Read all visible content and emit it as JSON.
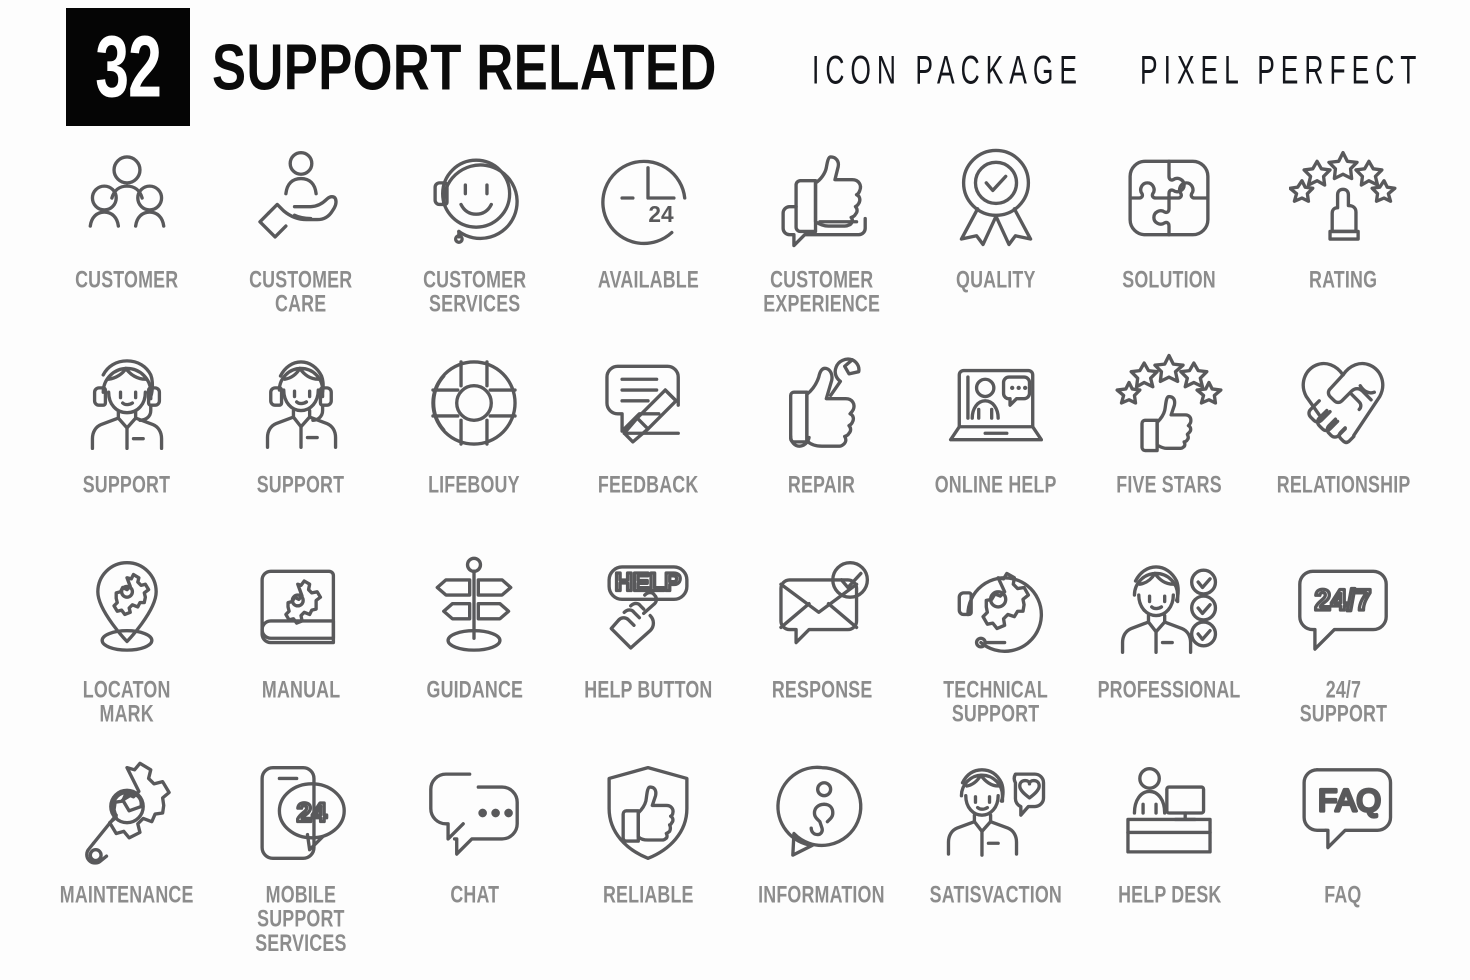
{
  "header": {
    "count": "32",
    "title": "SUPPORT RELATED",
    "subtitle_a": "ICON PACKAGE",
    "subtitle_b": "PIXEL PERFECT"
  },
  "colors": {
    "badge_background": "#050505",
    "badge_text": "#ffffff",
    "title_text": "#0b0b0b",
    "icon_stroke": "#59595b",
    "label_text": "#8c8c8c",
    "page_background": "#fdfdfd"
  },
  "grid": {
    "columns": 8,
    "rows": 4,
    "total_icons": 32
  },
  "icons": [
    {
      "label": "CUSTOMER",
      "icon": "three-people-group-icon"
    },
    {
      "label": "CUSTOMER\nCARE",
      "icon": "person-on-hand-icon"
    },
    {
      "label": "CUSTOMER\nSERVICES",
      "icon": "headset-smiley-face-icon"
    },
    {
      "label": "AVAILABLE",
      "icon": "clock-24-icon"
    },
    {
      "label": "CUSTOMER\nEXPERIENCE",
      "icon": "thumbs-up-speech-bubble-icon"
    },
    {
      "label": "QUALITY",
      "icon": "award-ribbon-check-icon"
    },
    {
      "label": "SOLUTION",
      "icon": "puzzle-pieces-icon"
    },
    {
      "label": "RATING",
      "icon": "hand-pointing-stars-icon"
    },
    {
      "label": "SUPPORT",
      "icon": "female-agent-headset-icon"
    },
    {
      "label": "SUPPORT",
      "icon": "agent-headset-icon"
    },
    {
      "label": "LIFEBOUY",
      "icon": "lifebuoy-ring-icon"
    },
    {
      "label": "FEEDBACK",
      "icon": "speech-bubble-pencil-icon"
    },
    {
      "label": "REPAIR",
      "icon": "thumbs-up-wrench-icon"
    },
    {
      "label": "ONLINE HELP",
      "icon": "laptop-chat-person-icon"
    },
    {
      "label": "FIVE STARS",
      "icon": "thumbs-up-five-stars-icon"
    },
    {
      "label": "RELATIONSHIP",
      "icon": "handshake-heart-icon"
    },
    {
      "label": "LOCATON\nMARK",
      "icon": "map-pin-gear-icon"
    },
    {
      "label": "MANUAL",
      "icon": "book-gear-icon"
    },
    {
      "label": "GUIDANCE",
      "icon": "signpost-direction-icon"
    },
    {
      "label": "HELP BUTTON",
      "icon": "help-button-hand-click-icon"
    },
    {
      "label": "RESPONSE",
      "icon": "envelope-check-bubble-icon"
    },
    {
      "label": "TECHNICAL\nSUPPORT",
      "icon": "gear-headset-icon"
    },
    {
      "label": "PROFESSIONAL",
      "icon": "female-agent-checklist-icon"
    },
    {
      "label": "24/7\nSUPPORT",
      "icon": "speech-bubble-247-icon"
    },
    {
      "label": "MAINTENANCE",
      "icon": "gear-wrench-icon"
    },
    {
      "label": "MOBILE SUPPORT\nSERVICES",
      "icon": "mobile-phone-24-bubble-icon"
    },
    {
      "label": "CHAT",
      "icon": "two-chat-bubbles-icon"
    },
    {
      "label": "RELIABLE",
      "icon": "shield-thumbs-up-icon"
    },
    {
      "label": "INFORMATION",
      "icon": "info-speech-bubble-icon"
    },
    {
      "label": "SATISVACTION",
      "icon": "person-heart-bubble-icon"
    },
    {
      "label": "HELP DESK",
      "icon": "help-desk-counter-icon"
    },
    {
      "label": "FAQ",
      "icon": "faq-speech-bubble-icon"
    }
  ],
  "icon_text_labels": {
    "available_clock": "24",
    "support_247": "24/7",
    "help_button": "HELP",
    "mobile_24": "24",
    "faq": "FAQ"
  }
}
